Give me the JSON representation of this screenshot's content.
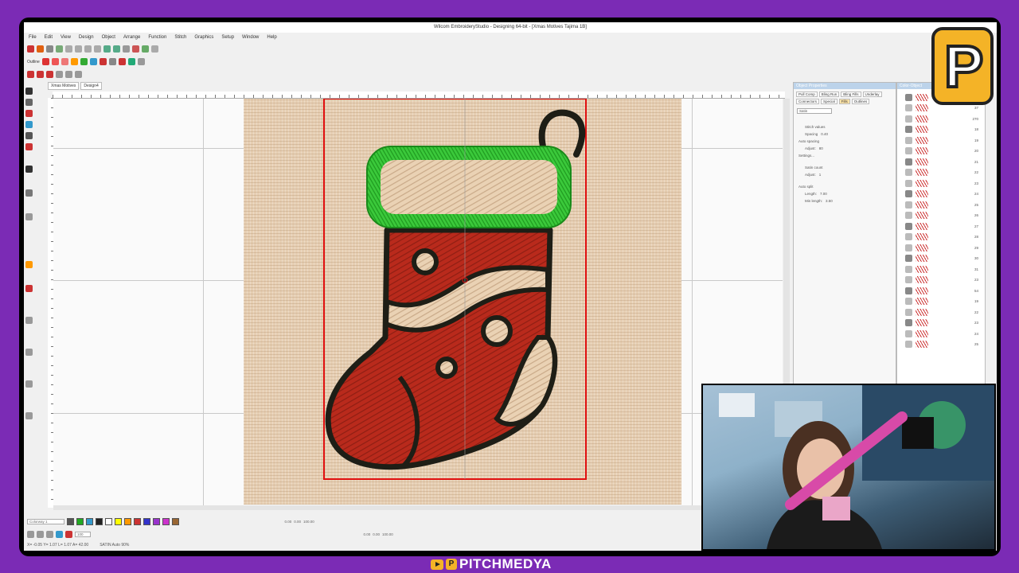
{
  "app": {
    "title": "Wilcom EmbroideryStudio - Designing 64-bit - [Xmas Motives     Tajima 1B]",
    "menus": [
      "File",
      "Edit",
      "View",
      "Design",
      "Object",
      "Arrange",
      "Function",
      "Stitch",
      "Graphics",
      "Setup",
      "Window",
      "Help"
    ],
    "outline_label": "Outline",
    "doc_tabs": [
      "Xmas Motives",
      "Design4"
    ]
  },
  "object_properties": {
    "header": "Object Properties",
    "tabs": [
      "Pull Comp",
      "Bling Run",
      "Bling Fills",
      "Underlay",
      "Connectors",
      "Special",
      "Fills",
      "Outlines"
    ],
    "fill_type": "Satin",
    "rows": [
      "Stitch values",
      "Spacing",
      "Auto spacing",
      "Adjust:",
      "Settings...",
      "Satin count",
      "Adjust:",
      "Auto split",
      "Length:",
      "Min length:"
    ],
    "values": {
      "spacing": "0.40",
      "auto_spacing": "80",
      "satin_count": "1",
      "length": "7.00",
      "min_length": "3.50"
    }
  },
  "color_object": {
    "header": "Color-Object",
    "numbers": [
      "31",
      "37",
      "270",
      "18",
      "19",
      "20",
      "21",
      "22",
      "23",
      "24",
      "25",
      "26",
      "27",
      "28",
      "29",
      "30",
      "31",
      "23",
      "54",
      "19",
      "22",
      "23",
      "24",
      "25"
    ]
  },
  "bottom_toolbar": {
    "colorway": "Colorway 1",
    "zoom": "100",
    "position_x": "0.00",
    "position_y": "0.00",
    "width": "0.00",
    "height": "0.00",
    "scale_w": "100.00",
    "scale_h": "100.00"
  },
  "status": {
    "coords": "X= -0.05 Y= 1.07 L= 1.07 A= 42.00",
    "stitch_info": "SATIN Auto 90%"
  },
  "colors": {
    "fabric": "#e6ceb2",
    "stocking_red": "#b92a1c",
    "cuff_green": "#3bc93b",
    "outline": "#1e1e16",
    "guide_red": "#e01010"
  },
  "branding": {
    "logo_letter": "P",
    "handle": "PITCHMEDYA"
  }
}
